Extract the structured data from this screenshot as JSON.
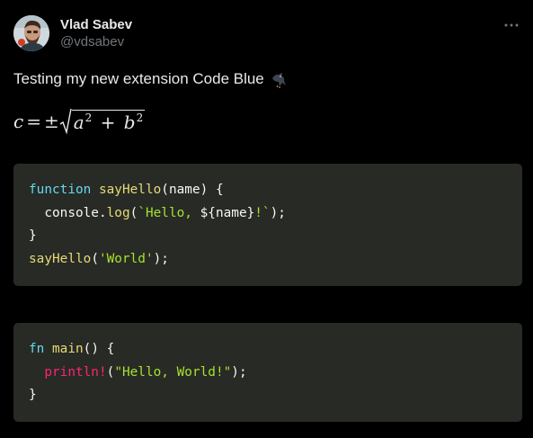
{
  "author": {
    "display_name": "Vlad Sabev",
    "handle": "@vdsabev"
  },
  "tweet": {
    "text": "Testing my new extension Code Blue"
  },
  "math": {
    "lhs": "c",
    "eq": "=",
    "pm": "±",
    "a": "a",
    "b": "b",
    "exp": "2",
    "plus": "+"
  },
  "code_js": {
    "l1": {
      "kw": "function",
      "sp1": " ",
      "fn": "sayHello",
      "rest": "(name) {"
    },
    "l2": {
      "pre": "  console.",
      "fn": "log",
      "open": "(",
      "str1": "`Hello, ",
      "interp": "${name}",
      "str2": "!`",
      "close": ");"
    },
    "l3": {
      "text": "}"
    },
    "l4": {
      "fn": "sayHello",
      "open": "(",
      "str": "'World'",
      "close": ");"
    }
  },
  "code_rs": {
    "l1": {
      "kw": "fn",
      "sp": " ",
      "fn": "main",
      "rest": "() {"
    },
    "l2": {
      "pre": "  ",
      "mac": "println!",
      "open": "(",
      "str": "\"Hello, World!\"",
      "close": ");"
    },
    "l3": {
      "text": "}"
    }
  },
  "colors": {
    "keyword": "#66d9ef",
    "function": "#e6db74",
    "string": "#a6e22e",
    "macro": "#f92672",
    "code_bg": "#282a26",
    "text": "#e7e9ea",
    "muted": "#71767b"
  },
  "icons": {
    "more": "more-horizontal-icon",
    "bird": "crow-emoji-icon"
  }
}
